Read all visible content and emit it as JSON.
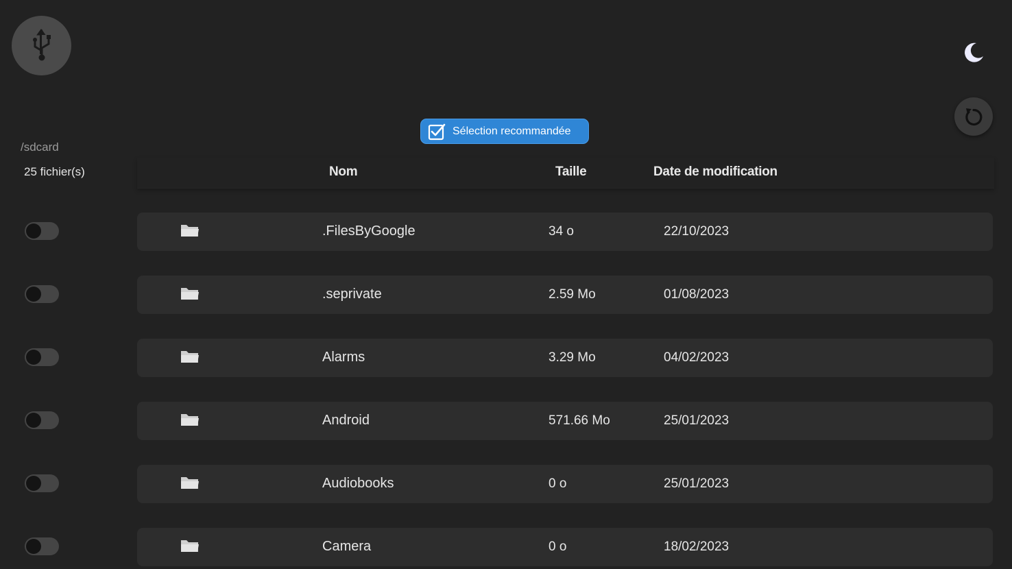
{
  "header": {
    "usb_icon": "usb-icon",
    "theme_icon": "moon-icon",
    "refresh_icon": "refresh-icon"
  },
  "recommend_button": {
    "label": "Sélection recommandée",
    "icon": "checkbox-icon",
    "color": "#2f86d6"
  },
  "path": "/sdcard",
  "file_count": "25 fichier(s)",
  "columns": {
    "name": "Nom",
    "size": "Taille",
    "date": "Date de modification"
  },
  "files": [
    {
      "name": ".FilesByGoogle",
      "size": "34 o",
      "date": "22/10/2023",
      "selected": false,
      "icon": "folder-icon"
    },
    {
      "name": ".seprivate",
      "size": "2.59 Mo",
      "date": "01/08/2023",
      "selected": false,
      "icon": "folder-icon"
    },
    {
      "name": "Alarms",
      "size": "3.29 Mo",
      "date": "04/02/2023",
      "selected": false,
      "icon": "folder-icon"
    },
    {
      "name": "Android",
      "size": "571.66 Mo",
      "date": "25/01/2023",
      "selected": false,
      "icon": "folder-icon"
    },
    {
      "name": "Audiobooks",
      "size": "0 o",
      "date": "25/01/2023",
      "selected": false,
      "icon": "folder-icon"
    },
    {
      "name": "Camera",
      "size": "0 o",
      "date": "18/02/2023",
      "selected": false,
      "icon": "folder-icon"
    }
  ],
  "colors": {
    "background": "#222222",
    "row": "#2d2d2d",
    "accent": "#2f86d6"
  }
}
